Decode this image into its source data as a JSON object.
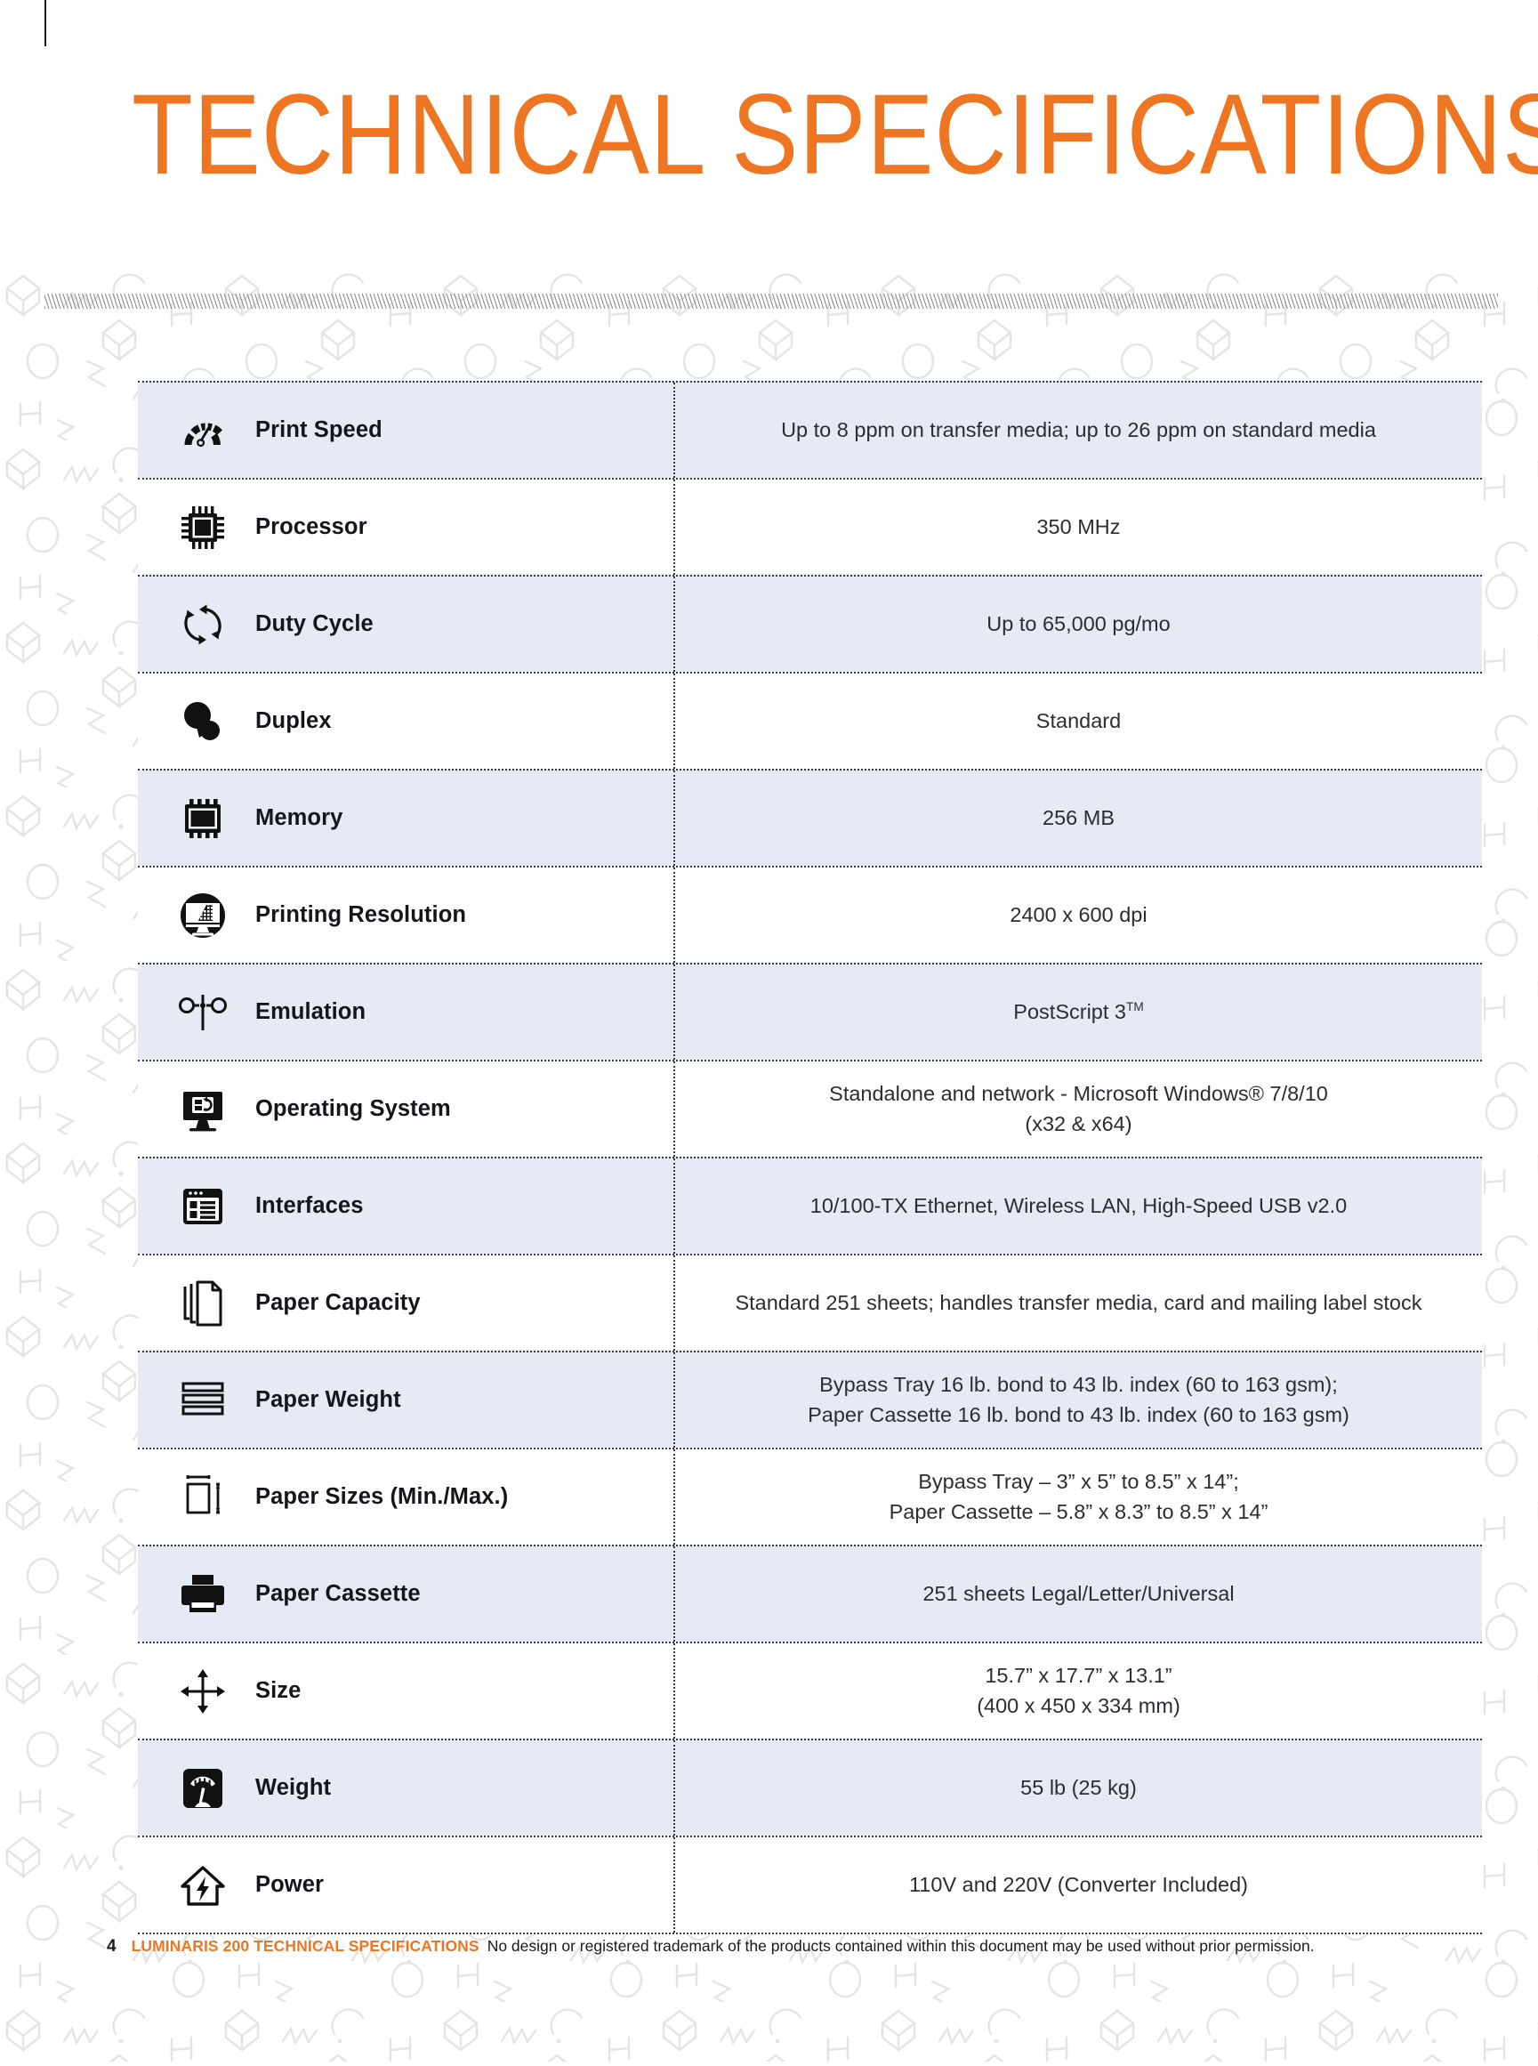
{
  "page": {
    "title": "TECHNICAL SPECIFICATIONS",
    "accent_color": "#ee7623",
    "row_highlight_color": "#e6eaf5"
  },
  "footer": {
    "page_number": "4",
    "brand": "LUMINARIS 200 TECHNICAL SPECIFICATIONS",
    "note": "No design or registered trademark of the products contained within this document may be used without prior permission."
  },
  "spec_table": {
    "rows": [
      {
        "icon": "speedometer-icon",
        "label": "Print Speed",
        "value": "Up to 8 ppm on transfer media; up to 26 ppm on standard media"
      },
      {
        "icon": "processor-chip-icon",
        "label": "Processor",
        "value": "350 MHz"
      },
      {
        "icon": "refresh-cycle-icon",
        "label": "Duty Cycle",
        "value": "Up to 65,000 pg/mo"
      },
      {
        "icon": "duplex-circles-icon",
        "label": "Duplex",
        "value": "Standard"
      },
      {
        "icon": "memory-module-icon",
        "label": "Memory",
        "value": "256 MB"
      },
      {
        "icon": "monitor-resolution-icon",
        "label": "Printing Resolution",
        "value": "2400 x 600 dpi"
      },
      {
        "icon": "emulation-nodes-icon",
        "label": "Emulation",
        "value_main": "PostScript 3",
        "value_sup": "TM"
      },
      {
        "icon": "operating-system-monitor-icon",
        "label": "Operating System",
        "value_line1": "Standalone and network - Microsoft Windows® 7/8/10",
        "value_line2": "(x32 & x64)"
      },
      {
        "icon": "interfaces-window-icon",
        "label": "Interfaces",
        "value": "10/100-TX Ethernet, Wireless LAN, High-Speed USB v2.0"
      },
      {
        "icon": "paper-stack-icon",
        "label": "Paper Capacity",
        "value": "Standard 251 sheets; handles transfer media, card and mailing label stock"
      },
      {
        "icon": "paper-weight-lines-icon",
        "label": "Paper Weight",
        "value_line1": "Bypass Tray 16 lb. bond to 43 lb. index (60 to 163 gsm);",
        "value_line2": "Paper Cassette 16 lb. bond to 43 lb. index (60 to 163 gsm)"
      },
      {
        "icon": "paper-size-measure-icon",
        "label": "Paper Sizes (Min./Max.)",
        "value_line1": "Bypass Tray – 3” x 5” to 8.5” x 14”;",
        "value_line2": "Paper Cassette – 5.8” x 8.3” to 8.5” x 14”"
      },
      {
        "icon": "printer-icon",
        "label": "Paper Cassette",
        "value": "251 sheets Legal/Letter/Universal"
      },
      {
        "icon": "size-arrows-icon",
        "label": "Size",
        "value_line1": "15.7” x 17.7” x 13.1”",
        "value_line2": "(400 x 450 x 334 mm)"
      },
      {
        "icon": "weight-scale-icon",
        "label": "Weight",
        "value": "55 lb (25 kg)"
      },
      {
        "icon": "power-bolt-house-icon",
        "label": "Power",
        "value": "110V and 220V (Converter Included)"
      }
    ]
  }
}
